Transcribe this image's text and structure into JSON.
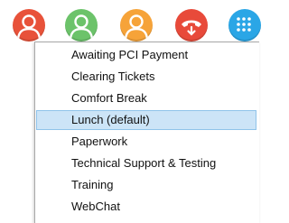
{
  "toolbar": {
    "buttons": [
      {
        "icon": "user-icon",
        "color": "#e8523a"
      },
      {
        "icon": "user-icon",
        "color": "#6cc36a"
      },
      {
        "icon": "user-icon",
        "color": "#f6a339"
      },
      {
        "icon": "hang-up-phone-icon",
        "color": "#e84a3a"
      },
      {
        "icon": "dialpad-icon",
        "color": "#2aa6e6"
      }
    ]
  },
  "menu": {
    "items": [
      {
        "label": "Awaiting PCI Payment",
        "selected": false
      },
      {
        "label": "Clearing Tickets",
        "selected": false
      },
      {
        "label": "Comfort Break",
        "selected": false
      },
      {
        "label": "Lunch (default)",
        "selected": true
      },
      {
        "label": "Paperwork",
        "selected": false
      },
      {
        "label": "Technical Support & Testing",
        "selected": false
      },
      {
        "label": "Training",
        "selected": false
      },
      {
        "label": "WebChat",
        "selected": false
      }
    ],
    "selected_bg": "#cce4f7",
    "selected_border": "#8fc3ea"
  }
}
